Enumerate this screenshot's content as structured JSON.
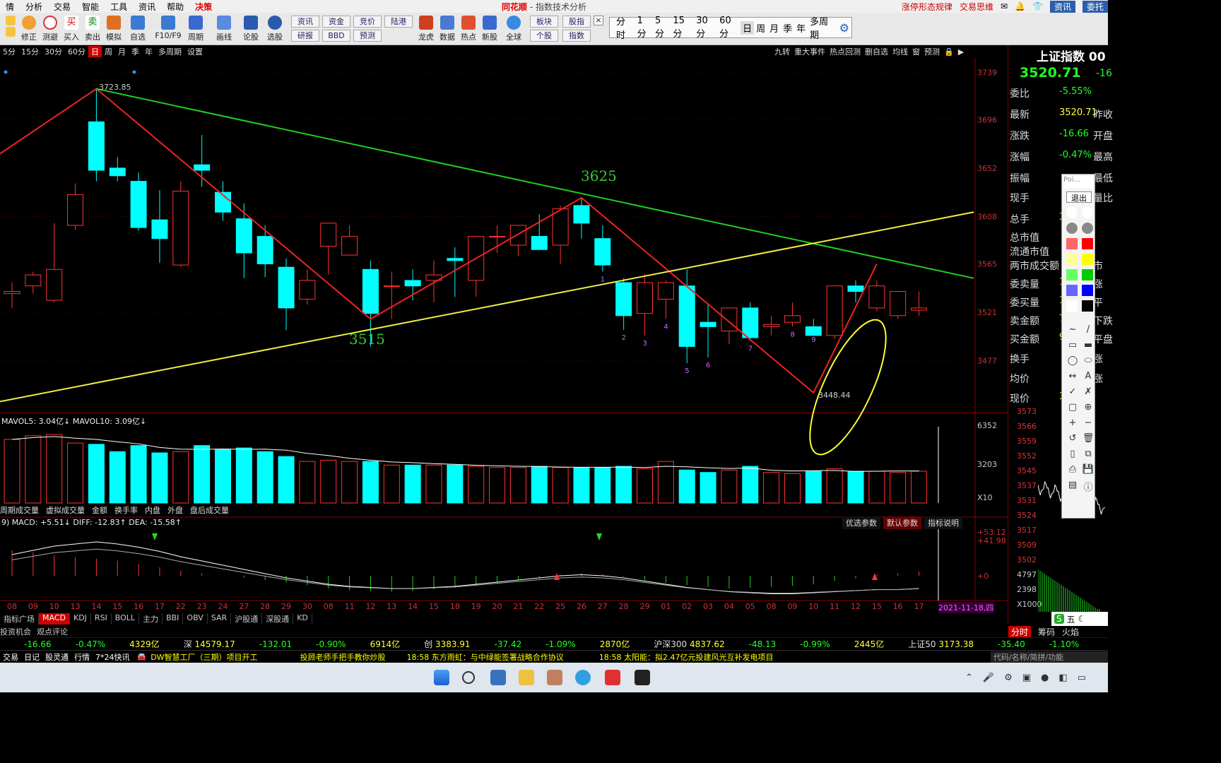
{
  "menu": {
    "items": [
      "情",
      "分析",
      "交易",
      "智能",
      "工具",
      "资讯",
      "帮助"
    ],
    "highlight": "决策",
    "logo": "同花顺",
    "title": "- 指数技术分析",
    "right_links": [
      "涨停形态规律",
      "交易思维"
    ],
    "right_btns": [
      "资讯",
      "委托"
    ]
  },
  "toolbar": {
    "buttons": [
      "修正",
      "测避",
      "买入",
      "卖出",
      "模拟",
      "自选",
      "F10/F9",
      "周期",
      "画线",
      "论股",
      "选股",
      "龙虎",
      "数据",
      "热点",
      "新股",
      "全球"
    ],
    "small_buttons": [
      "资讯",
      "资金",
      "竞价",
      "陆港",
      "研报",
      "BBD",
      "预测",
      "板块",
      "股指",
      "个股",
      "指数"
    ],
    "period_panel": [
      "分时",
      "1分",
      "5分",
      "15分",
      "30分",
      "60分",
      "日",
      "周",
      "月",
      "季",
      "年",
      "多周期"
    ]
  },
  "tabs": [
    "5分",
    "15分",
    "30分",
    "60分",
    "日",
    "周",
    "月",
    "季",
    "年",
    "多周期",
    "设置"
  ],
  "right_tabs": [
    "九转",
    "重大事件",
    "热点回测",
    "删自选",
    "均线",
    "窗",
    "预测"
  ],
  "chart_data": {
    "type": "candlestick",
    "x": [
      "08",
      "09",
      "10",
      "13",
      "14",
      "15",
      "16",
      "17",
      "22",
      "23",
      "24",
      "27",
      "28",
      "29",
      "30",
      "08",
      "11",
      "12",
      "13",
      "14",
      "15",
      "18",
      "19",
      "20",
      "21",
      "22",
      "25",
      "26",
      "27",
      "28",
      "29",
      "01",
      "02",
      "03",
      "04",
      "05",
      "08",
      "09",
      "10",
      "11",
      "12",
      "15",
      "16",
      "17"
    ],
    "y_ticks": [
      "3739",
      "3696",
      "3652",
      "3608",
      "3565",
      "3521",
      "3477"
    ],
    "annotations": [
      "3723.85",
      "3625",
      "3515",
      "3448.44"
    ],
    "count_labels": [
      "1",
      "2",
      "3",
      "4",
      "5",
      "6",
      "7",
      "8",
      "9"
    ],
    "volume": {
      "title": "MAVOL5: 3.04亿↓ MAVOL10: 3.09亿↓",
      "y_ticks": [
        "6352",
        "3203",
        "X10"
      ]
    },
    "macd": {
      "title": "9) MACD: +5.51↓ DIFF: -12.83↑ DEA: -15.58↑",
      "y_ticks": [
        "+53.12",
        "+41.98",
        "+0"
      ]
    },
    "date_label": "2021-11-18,四"
  },
  "volume_tabs": [
    "周期成交量",
    "虚拟成交量",
    "金额",
    "换手率",
    "内盘",
    "外盘",
    "盘后成交量"
  ],
  "macd_btns": [
    "优选参数",
    "默认参数",
    "指标说明"
  ],
  "indicator_tabs": [
    "指标广场",
    "MACD",
    "KDJ",
    "RSI",
    "BOLL",
    "主力",
    "BBI",
    "OBV",
    "SAR",
    "沪股通",
    "深股通",
    "KD"
  ],
  "bottom2": [
    "投资机会",
    "观点评论"
  ],
  "right_panel": {
    "name": "上证指数 00",
    "price": "3520.71",
    "price_chg": "-16",
    "rows": [
      [
        "委比",
        "-5.55%"
      ],
      [
        "最新",
        "3520.71",
        "昨收"
      ],
      [
        "涨跌",
        "-16.66",
        "开盘"
      ],
      [
        "涨幅",
        "-0.47%",
        "最高"
      ],
      [
        "振幅",
        "",
        "最低"
      ],
      [
        "现手",
        "",
        "量比"
      ],
      [
        "总手",
        "31",
        ""
      ],
      [
        "总市值",
        "",
        ""
      ],
      [
        "流通市值",
        "",
        ""
      ],
      [
        "两市成交额",
        "",
        "市"
      ],
      [
        "委卖量",
        "1",
        "涨"
      ],
      [
        "委买量",
        "1",
        "平"
      ],
      [
        "卖金额",
        "7",
        "下跌"
      ],
      [
        "买金额",
        "90",
        "平盘"
      ],
      [
        "换手",
        "",
        "涨"
      ],
      [
        "均价",
        "",
        "涨"
      ],
      [
        "现价",
        "3",
        ""
      ]
    ],
    "mini_ticks": [
      "3573",
      "3566",
      "3559",
      "3552",
      "3545",
      "3537",
      "3531",
      "3524",
      "3517",
      "3509",
      "3502",
      "4797",
      "2398",
      "X1000"
    ],
    "tabs": [
      "分时",
      "筹码",
      "火焰"
    ]
  },
  "palette": {
    "title": "Poi...",
    "exit": "退出"
  },
  "indexbar": [
    [
      "",
      "-16.66"
    ],
    [
      "",
      "-0.47%"
    ],
    [
      "",
      "4329亿"
    ],
    [
      "深",
      "14579.17"
    ],
    [
      "",
      "-132.01"
    ],
    [
      "",
      "-0.90%"
    ],
    [
      "",
      "6914亿"
    ],
    [
      "创",
      "3383.91"
    ],
    [
      "",
      "-37.42"
    ],
    [
      "",
      "-1.09%"
    ],
    [
      "",
      "2870亿"
    ],
    [
      "沪深300",
      "4837.62"
    ],
    [
      "",
      "-48.13"
    ],
    [
      "",
      "-0.99%"
    ],
    [
      "",
      "2445亿"
    ],
    [
      "上证50",
      "3173.38"
    ],
    [
      "",
      "-35.40"
    ],
    [
      "",
      "-1.10%"
    ]
  ],
  "news": [
    "交易",
    "日记",
    "股灵通",
    "行情",
    "7*24快讯"
  ],
  "news_items": [
    "DW智慧工厂（三期）项目开工",
    "投顾老师手把手教你炒股",
    "18:58 东方雨虹：与中绿能签署战略合作协议",
    "18:58 太阳能：拟2.47亿元投建风光互补发电项目"
  ],
  "search_hint": "代码/名称/简拼/功能",
  "ime": "五"
}
